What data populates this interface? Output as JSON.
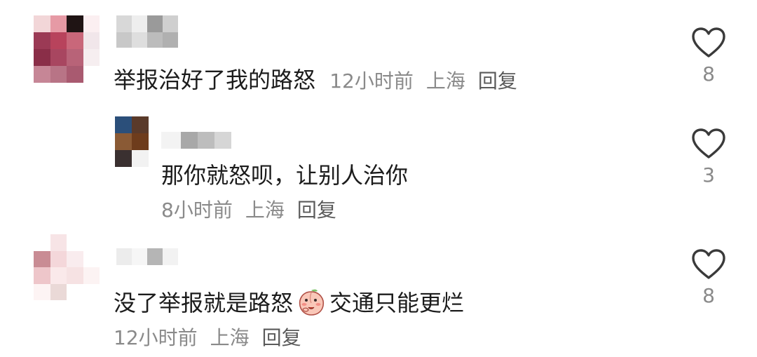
{
  "comments": [
    {
      "text": "举报治好了我的路怒",
      "time": "12小时前",
      "location": "上海",
      "reply_label": "回复",
      "likes": "8",
      "reply": {
        "text": "那你就怒呗，让别人治你",
        "time": "8小时前",
        "location": "上海",
        "reply_label": "回复",
        "likes": "3"
      }
    },
    {
      "text_before": "没了举报就是路怒",
      "emoji": "peach-face-emoji",
      "text_after": "交通只能更烂",
      "time": "12小时前",
      "location": "上海",
      "reply_label": "回复",
      "likes": "8"
    }
  ],
  "icons": {
    "like": "heart-outline-icon"
  },
  "colors": {
    "text": "#1c1c1c",
    "meta": "#8a8a8a",
    "heart_stroke": "#3a3a3a"
  }
}
